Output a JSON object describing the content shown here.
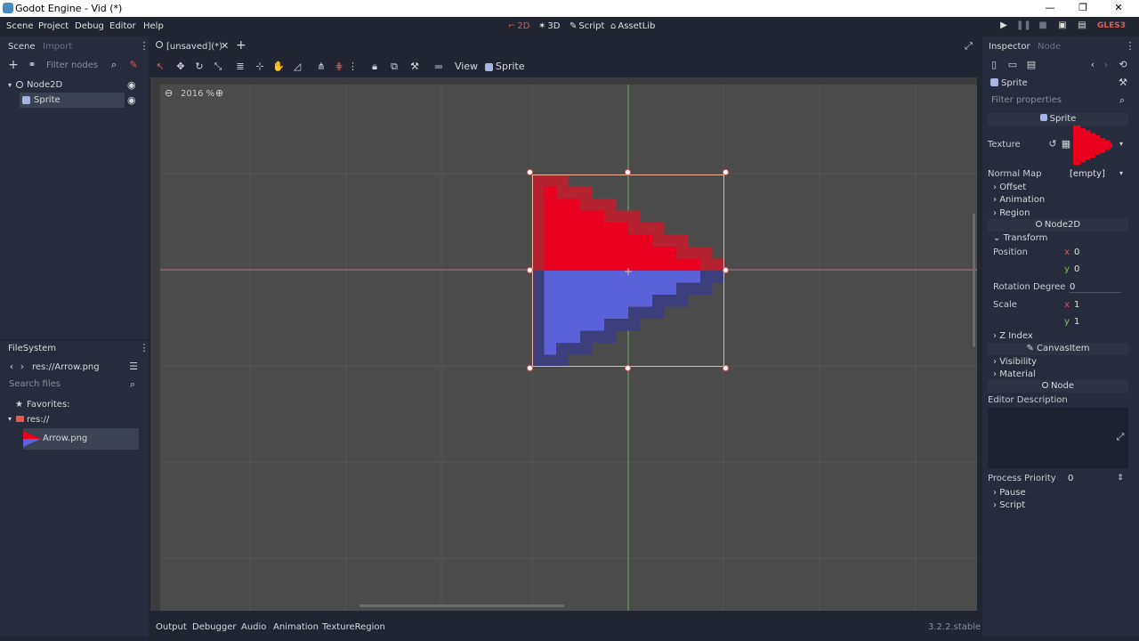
{
  "window": {
    "title": "Godot Engine - Vid (*)",
    "min": "—",
    "max": "❐",
    "close": "✕"
  },
  "menu": {
    "items": [
      "Scene",
      "Project",
      "Debug",
      "Editor",
      "Help"
    ]
  },
  "workspaces": {
    "2d": "2D",
    "3d": "3D",
    "script": "Script",
    "assetlib": "AssetLib"
  },
  "renderer": "GLES3",
  "scene_dock": {
    "tabs": [
      "Scene",
      "Import"
    ],
    "filter_placeholder": "Filter nodes",
    "tree": [
      {
        "name": "Node2D"
      },
      {
        "name": "Sprite"
      }
    ]
  },
  "filesystem": {
    "title": "FileSystem",
    "path": "res://Arrow.png",
    "search_placeholder": "Search files",
    "favorites": "Favorites:",
    "root": "res://",
    "files": [
      "Arrow.png"
    ]
  },
  "editor": {
    "tab": "[unsaved](*)",
    "view_menu": "View",
    "sprite_menu": "Sprite",
    "zoom": "2016 %"
  },
  "inspector": {
    "tabs": [
      "Inspector",
      "Node"
    ],
    "object": "Sprite",
    "filter_placeholder": "Filter properties",
    "sprite_section": "Sprite",
    "texture_label": "Texture",
    "normal_map_label": "Normal Map",
    "normal_map_value": "[empty]",
    "sprite_cats": [
      "Offset",
      "Animation",
      "Region"
    ],
    "node2d_section": "Node2D",
    "transform_label": "Transform",
    "position_label": "Position",
    "position_x": "0",
    "position_y": "0",
    "rotation_label": "Rotation Degree",
    "rotation_value": "0",
    "scale_label": "Scale",
    "scale_x": "1",
    "scale_y": "1",
    "zindex_label": "Z Index",
    "canvasitem_section": "CanvasItem",
    "canvas_cats": [
      "Visibility",
      "Material"
    ],
    "node_section": "Node",
    "editor_desc_label": "Editor Description",
    "priority_label": "Process Priority",
    "priority_value": "0",
    "node_cats": [
      "Pause",
      "Script"
    ],
    "axis_x": "x",
    "axis_y": "y"
  },
  "bottom_tabs": [
    "Output",
    "Debugger",
    "Audio",
    "Animation",
    "TextureRegion"
  ],
  "version": "3.2.2.stable",
  "colors": {
    "sprite_red": "#e8001c",
    "sprite_blue": "#5b62d9",
    "accent": "#478cbf"
  }
}
